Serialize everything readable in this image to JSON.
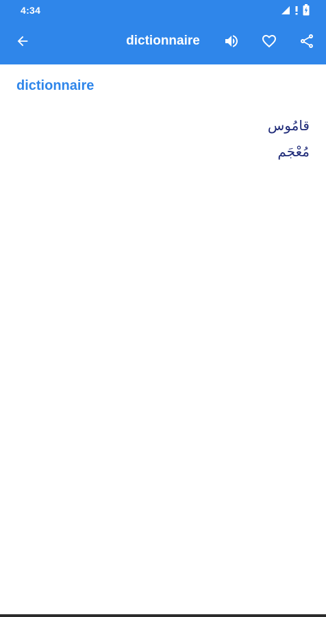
{
  "status_bar": {
    "time": "4:34"
  },
  "toolbar": {
    "title": "dictionnaire",
    "icons": [
      "back-arrow-icon",
      "speaker-icon",
      "heart-icon",
      "share-icon"
    ]
  },
  "entry": {
    "headword": "dictionnaire",
    "translations": [
      "قامُوس",
      "مُعْجَم"
    ]
  },
  "colors": {
    "app_bar": "#2f86ea",
    "headword": "#2f86ea",
    "translation_text": "#1e2a78",
    "background": "#ffffff"
  }
}
